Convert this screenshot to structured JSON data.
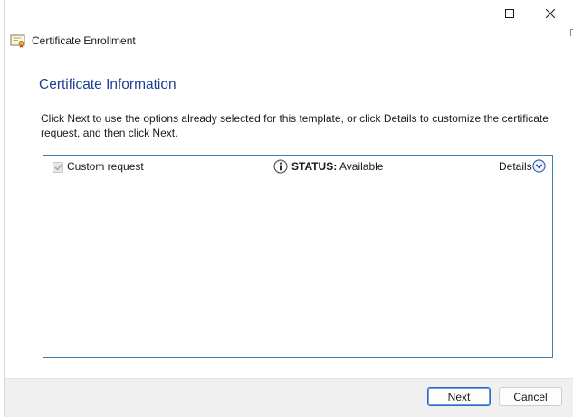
{
  "window": {
    "title": "Certificate Enrollment",
    "controls": {
      "minimize": "minimize-icon",
      "maximize": "maximize-icon",
      "close": "close-icon"
    }
  },
  "page": {
    "heading": "Certificate Information",
    "instructions": "Click Next to use the options already selected for this template, or click Details to customize the certificate request, and then click Next."
  },
  "requests": [
    {
      "label": "Custom request",
      "checked": true,
      "status_label": "STATUS:",
      "status_value": "Available",
      "details_label": "Details"
    }
  ],
  "footer": {
    "next_label": "Next",
    "cancel_label": "Cancel"
  },
  "colors": {
    "heading": "#1e3f8f",
    "list_border": "#3c7fb1",
    "footer_bg": "#f0f0f0"
  }
}
